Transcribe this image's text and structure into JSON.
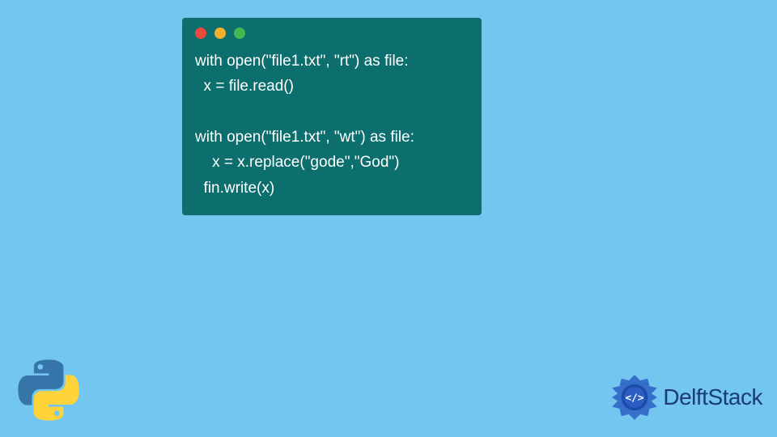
{
  "code": {
    "lines": [
      "with open(\"file1.txt\", \"rt\") as file:",
      "  x = file.read()",
      "  ",
      "with open(\"file1.txt\", \"wt\") as file:",
      "    x = x.replace(\"gode\",\"God\")",
      "  fin.write(x)"
    ]
  },
  "brand": {
    "name": "DelftStack"
  },
  "window": {
    "dots": [
      "red",
      "yellow",
      "green"
    ]
  },
  "colors": {
    "background": "#72c6ef",
    "codeWindow": "#0d6e6e",
    "codeText": "#ffffff",
    "brandText": "#1a3a7a"
  }
}
